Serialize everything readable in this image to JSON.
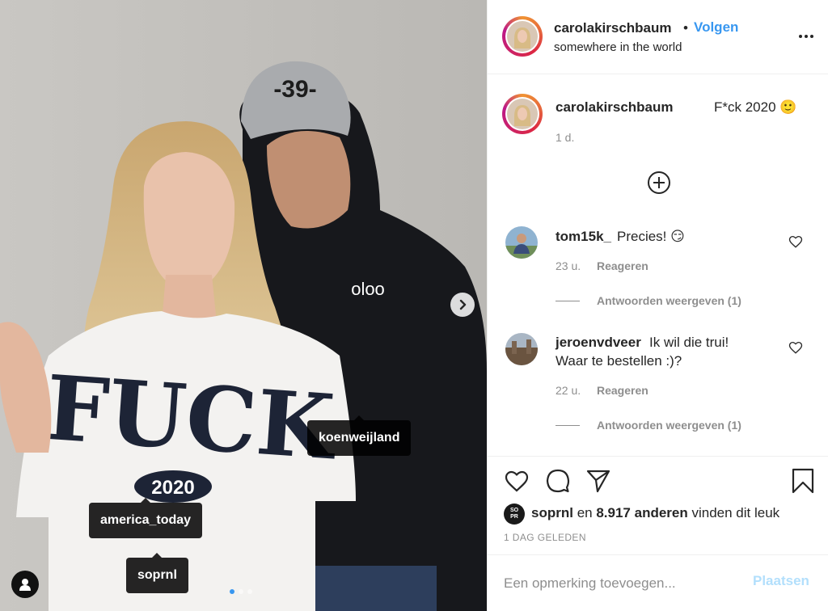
{
  "photo": {
    "tags": [
      "koenweijland",
      "america_today",
      "soprnl"
    ],
    "shirt_text": "FUCK",
    "shirt_year": "2020",
    "cap_text": "-39-",
    "carousel_dots": 3,
    "active_dot": 1
  },
  "header": {
    "username": "carolakirschbaum",
    "separator": "•",
    "follow_label": "Volgen",
    "location": "somewhere in the world"
  },
  "caption": {
    "username": "carolakirschbaum",
    "text": "F*ck 2020 🙂",
    "time": "1 d."
  },
  "comments": [
    {
      "username": "tom15k_",
      "text": "Precies! 😏",
      "time": "23 u.",
      "reply_label": "Reageren",
      "view_replies": "Antwoorden weergeven (1)"
    },
    {
      "username": "jeroenvdveer",
      "text_line1": "Ik wil die trui!",
      "text_line2": "Waar te bestellen :)?",
      "time": "22 u.",
      "reply_label": "Reageren",
      "view_replies": "Antwoorden weergeven (1)"
    }
  ],
  "likes": {
    "avatar_text_top": "SO",
    "avatar_text_bottom": "PR",
    "liker": "soprnl",
    "connector": "en",
    "others": "8.917 anderen",
    "suffix": "vinden dit leuk"
  },
  "post_date": "1 DAG GELEDEN",
  "comment_box": {
    "placeholder": "Een opmerking toevoegen...",
    "post_label": "Plaatsen"
  },
  "colors": {
    "accent": "#3897f0",
    "muted": "#8e8e8e",
    "post_disabled": "#b2dffc"
  }
}
